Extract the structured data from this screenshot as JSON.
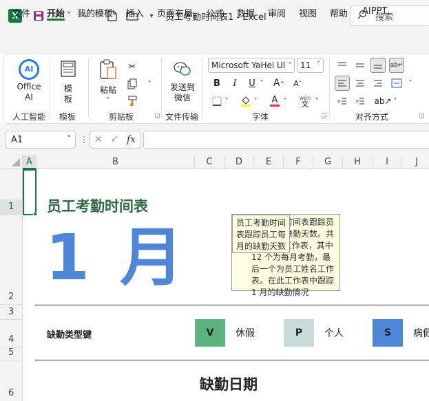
{
  "window": {
    "title": "员工考勤时间表1  -  Excel",
    "search_placeholder": "搜索"
  },
  "menu": {
    "tabs": [
      "文件",
      "开始",
      "我的模板",
      "插入",
      "页面布局",
      "公式",
      "数据",
      "审阅",
      "视图",
      "帮助",
      "AIPPT"
    ]
  },
  "ribbon": {
    "office_ai": "Office AI",
    "template": "模板",
    "paste": "粘贴",
    "send_wechat": "发送到微信",
    "font_name": "Microsoft YaHei UI",
    "font_size": "11",
    "groups": [
      "人工智能",
      "模板",
      "剪贴板",
      "文件传输",
      "字体",
      "对齐方式"
    ]
  },
  "formula_bar": {
    "name_box": "A1",
    "fx": "fx"
  },
  "columns": [
    "A",
    "B",
    "C",
    "D",
    "E",
    "F",
    "G",
    "H",
    "I",
    "J"
  ],
  "rows": [
    "1",
    "2",
    "3",
    "4",
    "5",
    "6"
  ],
  "sheet": {
    "title": "员工考勤时间表",
    "month": "1 月",
    "tooltip_back": "员工考勤时间表跟踪员工每月的缺勤天数。共有 13 个工作表，其中 12 个为每月考勤，最后一个为员工姓名工作表。在此工作表中跟踪 1 月的缺勤情况",
    "tooltip_front": "员工考勤时间表跟踪员工每月的缺勤天数",
    "key_label": "缺勤类型键",
    "keys": [
      {
        "code": "V",
        "label": "休假",
        "color": "#5db37e"
      },
      {
        "code": "P",
        "label": "个人",
        "color": "#c9dcdc"
      },
      {
        "code": "S",
        "label": "病假",
        "color": "#4f86d8"
      }
    ],
    "section_title": "缺勤日期"
  },
  "colors": {
    "excel_green": "#107c41",
    "title_green": "#2f6b47",
    "month_blue": "#4f86d8"
  }
}
